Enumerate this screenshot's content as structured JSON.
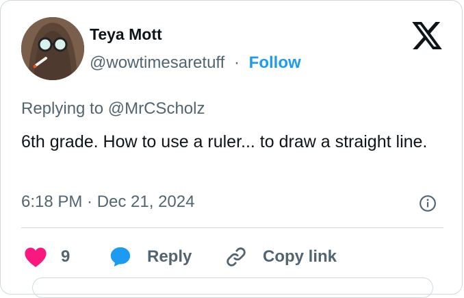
{
  "author": {
    "name": "Teya Mott",
    "handle": "@wowtimesaretuff",
    "separator": "·",
    "follow_label": "Follow"
  },
  "tweet": {
    "replying_prefix": "Replying to ",
    "replying_to": "@MrCScholz",
    "text": "6th grade. How to use a ruler... to draw a straight line.",
    "timestamp": "6:18 PM · Dec 21, 2024"
  },
  "actions": {
    "like_count": "9",
    "reply_label": "Reply",
    "copy_link_label": "Copy link"
  },
  "colors": {
    "like": "#f91880",
    "reply": "#1d9bf0",
    "link": "#1d9bf0",
    "muted": "#536471"
  },
  "icons": {
    "brand": "x-logo-icon",
    "info": "info-icon",
    "like": "heart-icon",
    "reply": "reply-bubble-icon",
    "copy": "link-icon"
  }
}
